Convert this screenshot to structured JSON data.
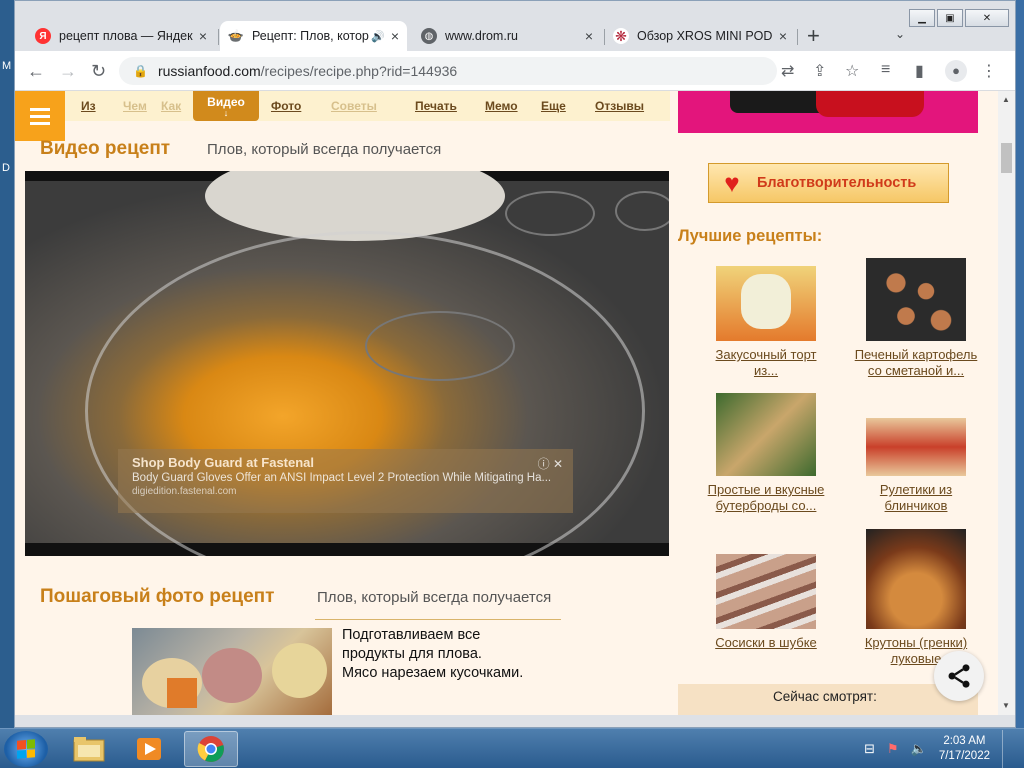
{
  "desktop": {
    "edge_letters": [
      "M",
      "D"
    ]
  },
  "window": {
    "controls": [
      "minimize",
      "restore",
      "close"
    ]
  },
  "tabs": [
    {
      "title": "рецепт плова — Яндекс",
      "favicon": "yandex-icon",
      "close": "×"
    },
    {
      "title": "Рецепт: Плов, который",
      "favicon": "russianfood-icon",
      "close": "×",
      "active": true,
      "audio": "🔊"
    },
    {
      "title": "www.drom.ru",
      "favicon": "globe-icon",
      "close": "×"
    },
    {
      "title": "Обзор XROS MINI POD",
      "favicon": "snowflake-icon",
      "close": "×"
    }
  ],
  "new_tab": "+",
  "tab_search": "⌄",
  "address": {
    "host": "russianfood.com",
    "path": "/recipes/recipe.php?rid=144936"
  },
  "site_menu": {
    "items": [
      {
        "label": "Из",
        "faded": false
      },
      {
        "label": "Чем",
        "faded": true
      },
      {
        "label": "Как",
        "faded": true
      },
      {
        "label": "Видео",
        "active": true,
        "arrow": "↓"
      },
      {
        "label": "Фото",
        "faded": false
      },
      {
        "label": "Советы",
        "faded": true
      },
      {
        "label": "Печать",
        "faded": false
      },
      {
        "label": "Мемо",
        "faded": false
      },
      {
        "label": "Еще",
        "faded": false
      },
      {
        "label": "Отзывы",
        "faded": false
      }
    ]
  },
  "video_section": {
    "title": "Видео рецепт",
    "subtitle": "Плов, который всегда получается"
  },
  "video_ad": {
    "headline": "Shop Body Guard at Fastenal",
    "body": "Body Guard Gloves Offer an ANSI Impact Level 2 Protection While Mitigating Ha...",
    "url": "digiedition.fastenal.com",
    "info": "ⓘ ✕"
  },
  "photo_section": {
    "title": "Пошаговый фото рецепт",
    "subtitle": "Плов, который всегда получается"
  },
  "step1": {
    "lines": [
      "Подготавливаем все",
      "продукты для плова.",
      "Мясо нарезаем кусочками."
    ]
  },
  "sidebar": {
    "charity": "Благотворительность",
    "best_title": "Лучшие рецепты:",
    "recipes": [
      {
        "line1": "Закусочный торт",
        "line2": "из..."
      },
      {
        "line1": "Печеный картофель",
        "line2": "со сметаной и..."
      },
      {
        "line1": "Простые и вкусные",
        "line2": "бутерброды со..."
      },
      {
        "line1": "Рулетики из",
        "line2": "блинчиков"
      },
      {
        "line1": "Сосиски в шубке",
        "line2": ""
      },
      {
        "line1": "Крутоны (гренки)",
        "line2": "луковые"
      }
    ],
    "now_watching": "Сейчас смотрят:"
  },
  "taskbar": {
    "time": "2:03 AM",
    "date": "7/17/2022",
    "apps": [
      "explorer-icon",
      "media-player-icon",
      "chrome-icon"
    ]
  },
  "colors": {
    "accent": "#c8801a",
    "menu_active": "#d18a1c",
    "hamburger": "#f7a21b",
    "link": "#6b4a1e"
  }
}
